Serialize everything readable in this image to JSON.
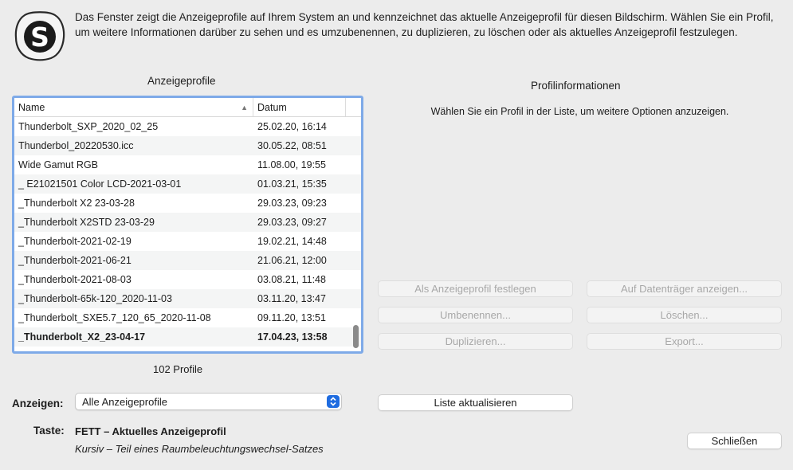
{
  "intro_text": "Das Fenster zeigt die Anzeigeprofile auf Ihrem System an und kennzeichnet das aktuelle Anzeigeprofil für diesen Bildschirm. Wählen Sie ein Profil, um weitere Informationen darüber zu sehen und es umzubenennen, zu duplizieren, zu löschen oder als aktuelles Anzeigeprofil festzulegen.",
  "logo_letter": "S",
  "profiles": {
    "title": "Anzeigeprofile",
    "columns": {
      "name": "Name",
      "date": "Datum"
    },
    "rows": [
      {
        "name": "Thunderbolt_SXP_2020_02_25",
        "date": "25.02.20, 16:14"
      },
      {
        "name": "Thunderbol_20220530.icc",
        "date": "30.05.22, 08:51"
      },
      {
        "name": "Wide Gamut RGB",
        "date": "11.08.00, 19:55"
      },
      {
        "name": "_ E21021501 Color LCD-2021-03-01",
        "date": "01.03.21, 15:35"
      },
      {
        "name": "_Thunderbolt X2 23-03-28",
        "date": "29.03.23, 09:23"
      },
      {
        "name": "_Thunderbolt X2STD 23-03-29",
        "date": "29.03.23, 09:27"
      },
      {
        "name": "_Thunderbolt-2021-02-19",
        "date": "19.02.21, 14:48"
      },
      {
        "name": "_Thunderbolt-2021-06-21",
        "date": "21.06.21, 12:00"
      },
      {
        "name": "_Thunderbolt-2021-08-03",
        "date": "03.08.21, 11:48"
      },
      {
        "name": "_Thunderbolt-65k-120_2020-11-03",
        "date": "03.11.20, 13:47"
      },
      {
        "name": "_Thunderbolt_SXE5.7_120_65_2020-11-08",
        "date": "09.11.20, 13:51"
      },
      {
        "name": "_Thunderbolt_X2_23-04-17",
        "date": "17.04.23, 13:58"
      }
    ],
    "current_index": 11,
    "count_label": "102 Profile"
  },
  "filter": {
    "label": "Anzeigen:",
    "value": "Alle Anzeigeprofile"
  },
  "legend": {
    "label": "Taste:",
    "bold_line": "FETT – Aktuelles Anzeigeprofil",
    "italic_line": "Kursiv – Teil eines Raumbeleuchtungswechsel-Satzes"
  },
  "info": {
    "title": "Profilinformationen",
    "hint": "Wählen Sie ein Profil in der Liste, um weitere Optionen anzuzeigen."
  },
  "buttons": {
    "set_current": "Als Anzeigeprofil festlegen",
    "show_on_disk": "Auf Datenträger anzeigen...",
    "rename": "Umbenennen...",
    "delete": "Löschen...",
    "duplicate": "Duplizieren...",
    "export": "Export...",
    "refresh": "Liste aktualisieren",
    "close": "Schließen"
  },
  "colors": {
    "accent": "#1f6ce0",
    "focus_ring": "#7eaae8"
  }
}
